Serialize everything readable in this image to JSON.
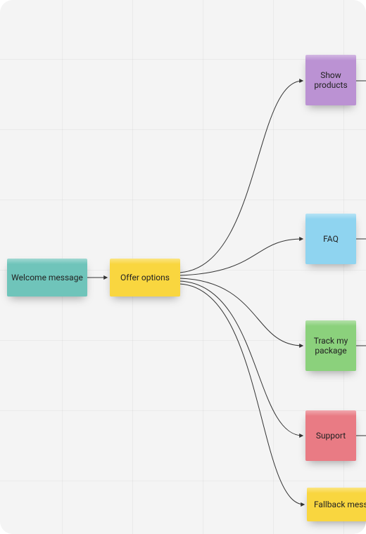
{
  "nodes": {
    "welcome": {
      "label": "Welcome message",
      "color": "teal"
    },
    "offer": {
      "label": "Offer options",
      "color": "yellow"
    },
    "show_products": {
      "label": "Show products",
      "color": "purple"
    },
    "faq": {
      "label": "FAQ",
      "color": "blue"
    },
    "track": {
      "label": "Track my package",
      "color": "green"
    },
    "support": {
      "label": "Support",
      "color": "red"
    },
    "fallback": {
      "label": "Fallback message",
      "color": "yellow"
    }
  }
}
